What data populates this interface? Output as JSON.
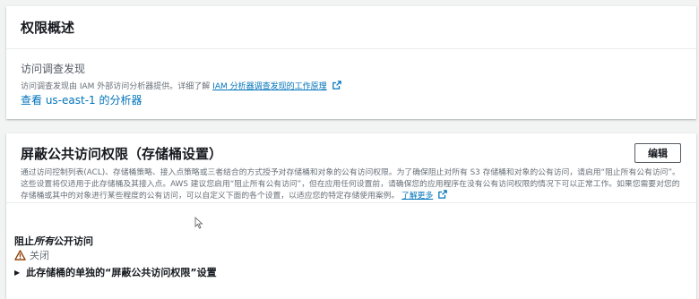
{
  "overview": {
    "title": "权限概述",
    "access_analyzer_label": "访问调查发现",
    "description_prefix": "访问调查发现由 IAM 外部访问分析器提供。详细了解 ",
    "learn_link": "IAM 分析器调查发现的工作原理",
    "analyzer_link": "查看 us-east-1 的分析器"
  },
  "block_public": {
    "title": "屏蔽公共访问权限（存储桶设置）",
    "edit_label": "编辑",
    "description": "通过访问控制列表(ACL)、存储桶策略、接入点策略或三者结合的方式授予对存储桶和对象的公有访问权限。为了确保阻止对所有 S3 存储桶和对象的公有访问，请启用“阻止所有公有访问”。这些设置将仅适用于此存储桶及其接入点。AWS 建议您启用“阻止所有公有访问”，但在应用任何设置前，请确保您的应用程序在没有公有访问权限的情况下可以正常工作。如果您需要对您的存储桶或其中的对象进行某些程度的公有访问，可以自定义下面的各个设置，以适应您的特定存储使用案例。",
    "learn_more": "了解更多",
    "block_label_prefix": "阻止",
    "block_label_italic": "所有",
    "block_label_suffix": "公开访问",
    "status": "关闭",
    "expander": "此存储桶的单独的“屏蔽公共访问权限”设置"
  },
  "colors": {
    "link": "#0073bb",
    "warning": "#8b3a00",
    "text": "#16191f",
    "muted": "#687078"
  },
  "icons": [
    "external-link-icon",
    "warning-icon",
    "caret-right-icon",
    "mouse-cursor-icon"
  ]
}
